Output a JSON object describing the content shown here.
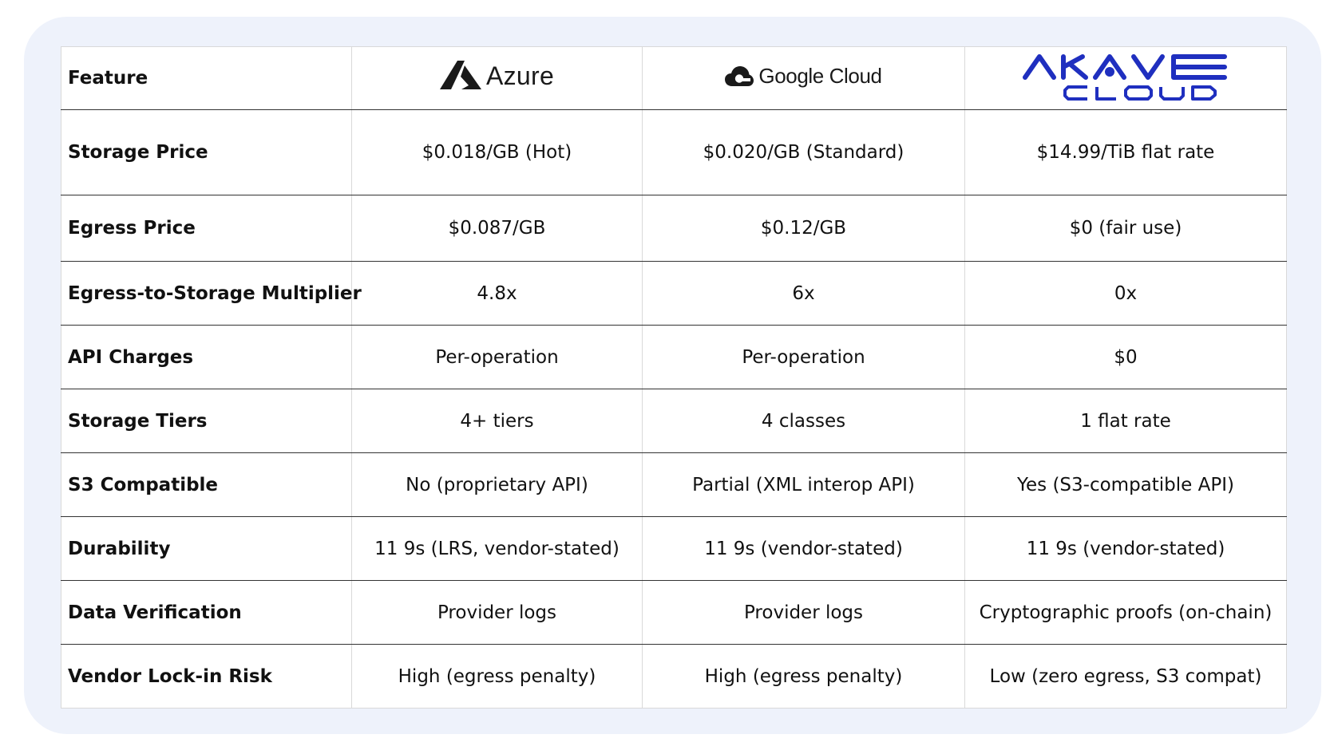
{
  "header": {
    "feature_label": "Feature",
    "providers": [
      {
        "name": "Azure",
        "icon": "azure-logo-icon"
      },
      {
        "name": "Google Cloud",
        "icon": "google-cloud-logo-icon"
      },
      {
        "name": "AKAVE CLOUD",
        "icon": "akave-cloud-logo-icon",
        "color": "#1f2fbf"
      }
    ]
  },
  "rows": [
    {
      "feature": "Storage Price",
      "azure": "$0.018/GB (Hot)",
      "google": "$0.020/GB (Standard)",
      "akave": "$14.99/TiB flat rate"
    },
    {
      "feature": "Egress Price",
      "azure": "$0.087/GB",
      "google": "$0.12/GB",
      "akave": "$0 (fair use)"
    },
    {
      "feature": "Egress-to-Storage Multiplier",
      "azure": "4.8x",
      "google": "6x",
      "akave": "0x"
    },
    {
      "feature": "API Charges",
      "azure": "Per-operation",
      "google": "Per-operation",
      "akave": "$0"
    },
    {
      "feature": "Storage Tiers",
      "azure": "4+ tiers",
      "google": "4 classes",
      "akave": "1 flat rate"
    },
    {
      "feature": "S3 Compatible",
      "azure": "No (proprietary API)",
      "google": "Partial (XML interop API)",
      "akave": "Yes (S3-compatible API)"
    },
    {
      "feature": "Durability",
      "azure": "11 9s (LRS, vendor-stated)",
      "google": "11 9s (vendor-stated)",
      "akave": "11 9s (vendor-stated)"
    },
    {
      "feature": "Data Verification",
      "azure": "Provider logs",
      "google": "Provider logs",
      "akave": "Cryptographic proofs (on-chain)"
    },
    {
      "feature": "Vendor Lock-in Risk",
      "azure": "High (egress penalty)",
      "google": "High (egress penalty)",
      "akave": "Low (zero egress, S3 compat)"
    }
  ],
  "colors": {
    "card_background": "#eef2fb",
    "akave_brand": "#1f2fbf"
  }
}
